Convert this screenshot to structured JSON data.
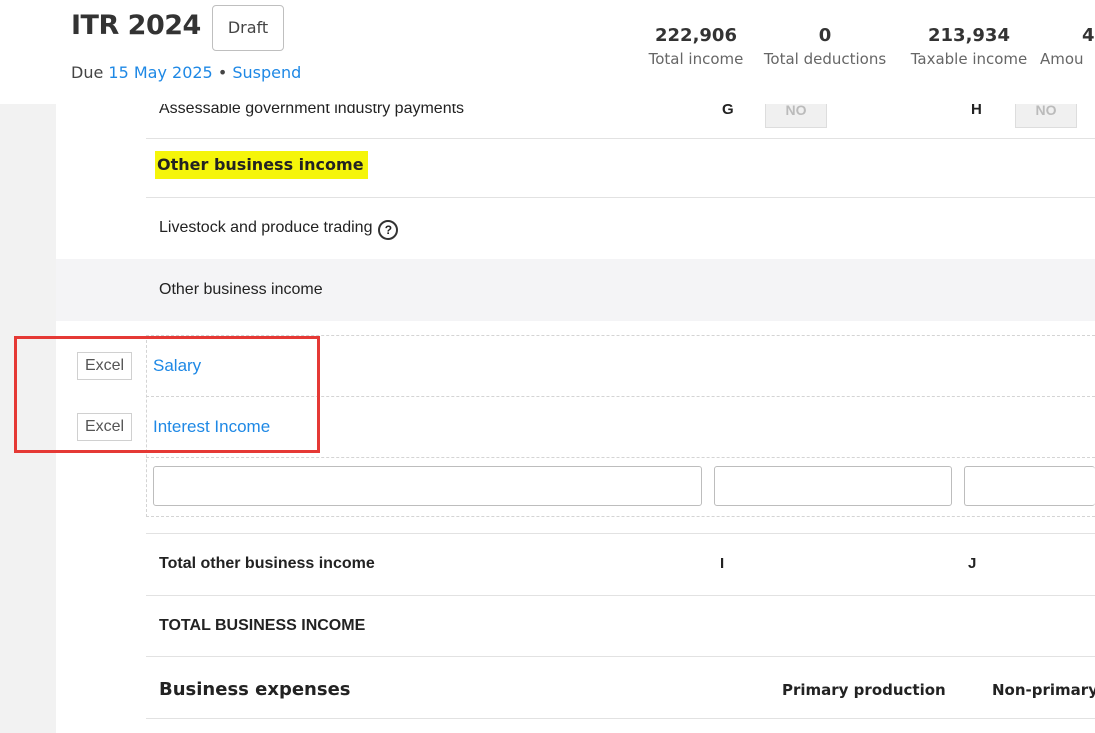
{
  "header": {
    "title": "ITR 2024",
    "status_badge": "Draft",
    "due_prefix": "Due",
    "due_date": "15 May 2025",
    "separator": "•",
    "suspend_link": "Suspend",
    "stats": [
      {
        "value": "222,906",
        "label": "Total income"
      },
      {
        "value": "0",
        "label": "Total deductions"
      },
      {
        "value": "213,934",
        "label": "Taxable income"
      },
      {
        "value": "4",
        "label": "Amou"
      }
    ]
  },
  "rows": {
    "gov_payments": {
      "label": "Assessable government industry payments",
      "code_g": "G",
      "value_g": "NO",
      "code_h": "H",
      "value_h": "NO"
    },
    "other_heading": "Other business income",
    "livestock": {
      "label": "Livestock and produce trading",
      "help_icon": "?"
    },
    "other_subheading": "Other business income",
    "entries": [
      {
        "excel_label": "Excel",
        "link": "Salary"
      },
      {
        "excel_label": "Excel",
        "link": "Interest Income"
      }
    ],
    "total_other": {
      "label": "Total other business income",
      "code_i": "I",
      "code_j": "J"
    },
    "total_business": "TOTAL BUSINESS INCOME",
    "expenses": {
      "label": "Business expenses",
      "col1": "Primary production",
      "col2": "Non-primary"
    }
  },
  "colors": {
    "link": "#1e88e5",
    "highlight": "#f5f50a",
    "annotation_box": "#e53935"
  }
}
